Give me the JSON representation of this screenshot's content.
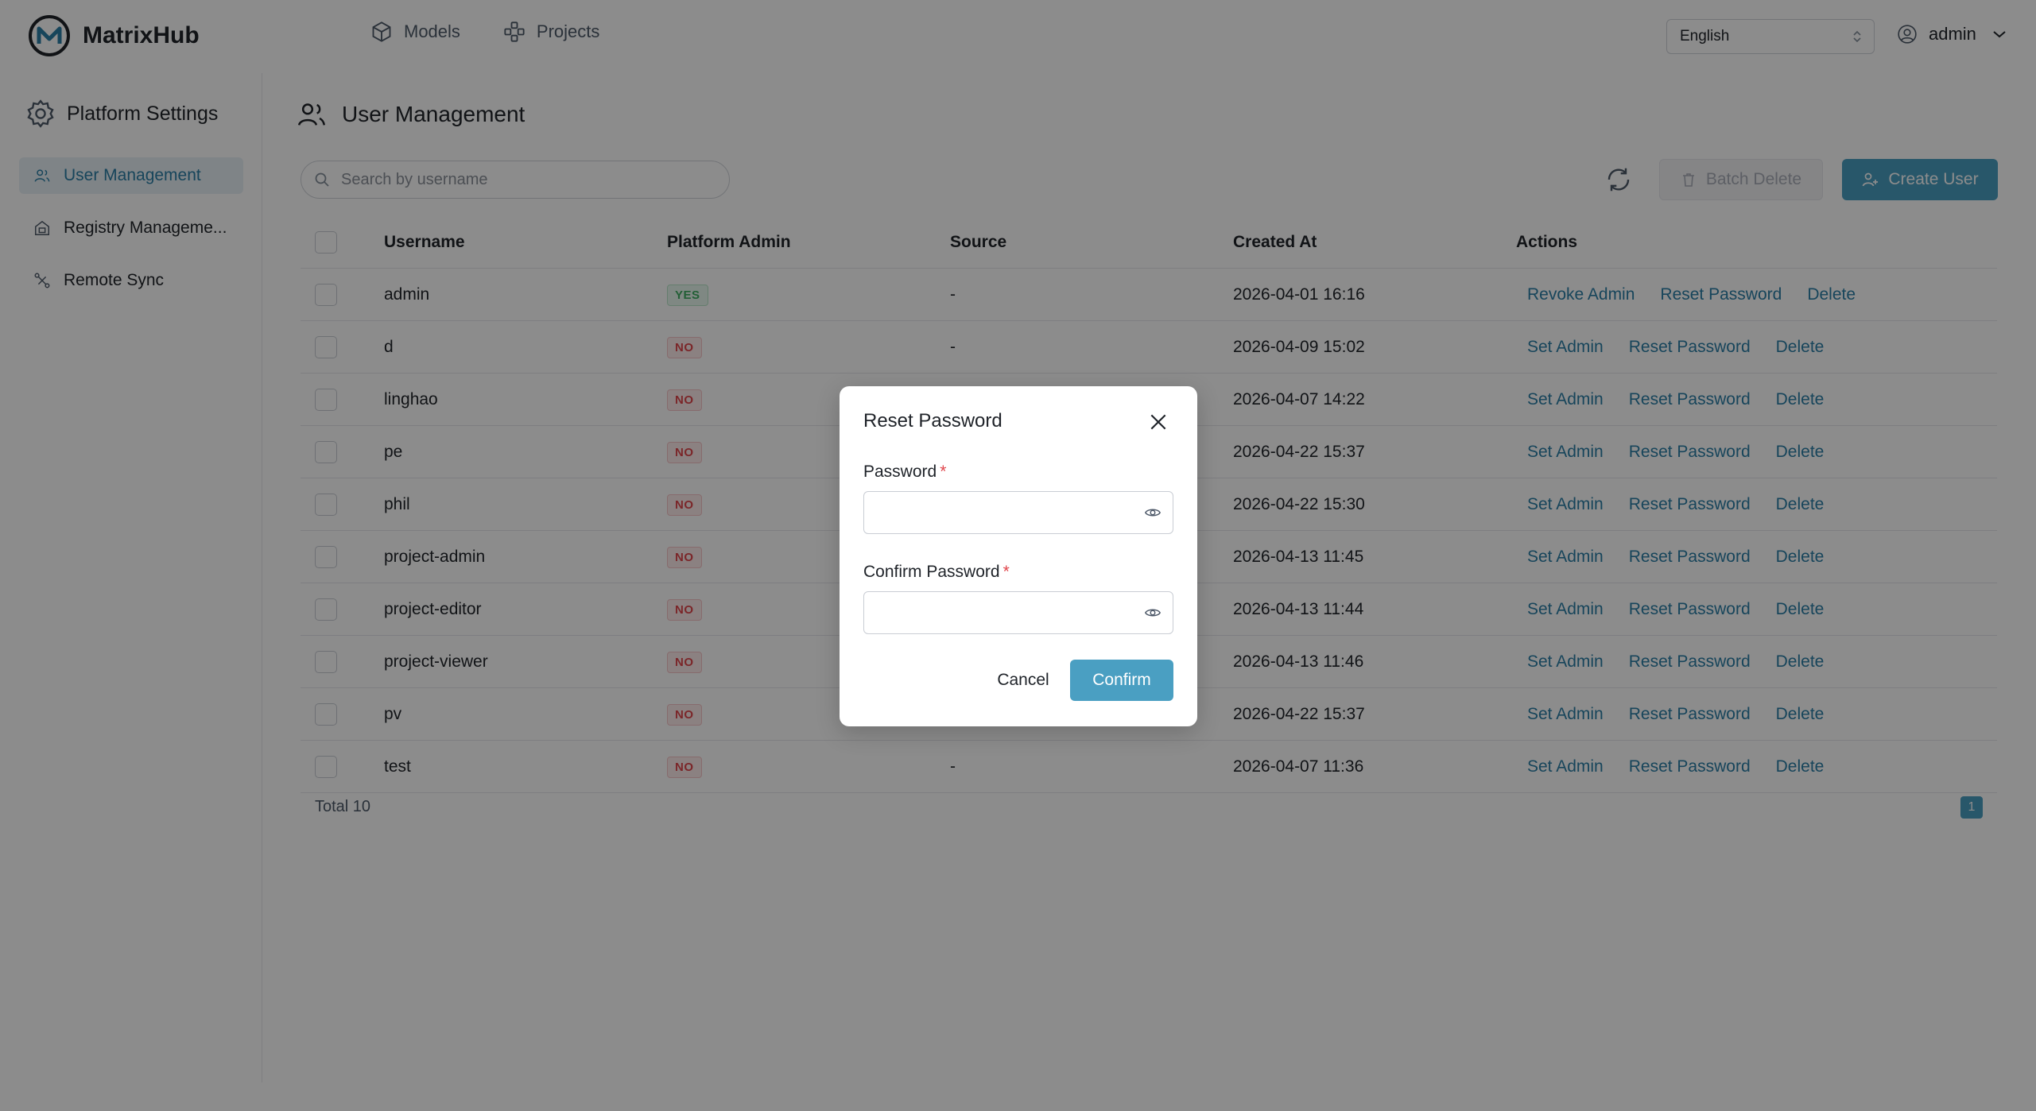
{
  "app": {
    "name": "MatrixHub"
  },
  "nav": [
    {
      "label": "Models",
      "icon": "cube-icon"
    },
    {
      "label": "Projects",
      "icon": "projects-icon"
    }
  ],
  "language": {
    "selected": "English"
  },
  "user": {
    "name": "admin"
  },
  "sidebar": {
    "title": "Platform Settings",
    "items": [
      {
        "label": "User Management",
        "icon": "users-icon",
        "active": true
      },
      {
        "label": "Registry Manageme...",
        "icon": "registry-icon",
        "active": false
      },
      {
        "label": "Remote Sync",
        "icon": "sync-icon",
        "active": false
      }
    ]
  },
  "page": {
    "title": "User Management",
    "search_placeholder": "Search by username",
    "batch_delete_label": "Batch Delete",
    "create_user_label": "Create User"
  },
  "table": {
    "headers": {
      "username": "Username",
      "platform_admin": "Platform Admin",
      "source": "Source",
      "created_at": "Created At",
      "actions": "Actions"
    },
    "rows": [
      {
        "username": "admin",
        "admin": "YES",
        "source": "-",
        "created": "2026-04-01 16:16",
        "toggle": "Revoke Admin"
      },
      {
        "username": "d",
        "admin": "NO",
        "source": "-",
        "created": "2026-04-09 15:02",
        "toggle": "Set Admin"
      },
      {
        "username": "linghao",
        "admin": "NO",
        "source": "",
        "created": "2026-04-07 14:22",
        "toggle": "Set Admin"
      },
      {
        "username": "pe",
        "admin": "NO",
        "source": "",
        "created": "2026-04-22 15:37",
        "toggle": "Set Admin"
      },
      {
        "username": "phil",
        "admin": "NO",
        "source": "",
        "created": "2026-04-22 15:30",
        "toggle": "Set Admin"
      },
      {
        "username": "project-admin",
        "admin": "NO",
        "source": "",
        "created": "2026-04-13 11:45",
        "toggle": "Set Admin"
      },
      {
        "username": "project-editor",
        "admin": "NO",
        "source": "",
        "created": "2026-04-13 11:44",
        "toggle": "Set Admin"
      },
      {
        "username": "project-viewer",
        "admin": "NO",
        "source": "",
        "created": "2026-04-13 11:46",
        "toggle": "Set Admin"
      },
      {
        "username": "pv",
        "admin": "NO",
        "source": "",
        "created": "2026-04-22 15:37",
        "toggle": "Set Admin"
      },
      {
        "username": "test",
        "admin": "NO",
        "source": "-",
        "created": "2026-04-07 11:36",
        "toggle": "Set Admin"
      }
    ],
    "reset_label": "Reset Password",
    "delete_label": "Delete"
  },
  "pagination": {
    "total": "Total 10",
    "current": "1"
  },
  "modal": {
    "title": "Reset Password",
    "password_label": "Password",
    "confirm_label": "Confirm Password",
    "required_mark": "*",
    "password_value": "",
    "confirm_value": "",
    "cancel_label": "Cancel",
    "confirm_button": "Confirm"
  },
  "colors": {
    "primary": "#4a9fc2",
    "link": "#2b7ea6",
    "yes": "#3eae63",
    "no": "#e0454b"
  }
}
